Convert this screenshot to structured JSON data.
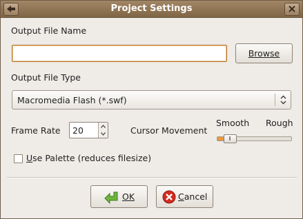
{
  "window": {
    "title": "Project Settings"
  },
  "output_file_name": {
    "label": "Output File Name",
    "value": "",
    "browse_button": "Browse"
  },
  "output_file_type": {
    "label": "Output File Type",
    "selected": "Macromedia Flash (*.swf)"
  },
  "frame_rate": {
    "label": "Frame Rate",
    "value": "20"
  },
  "cursor_movement": {
    "label": "Cursor Movement",
    "min_label": "Smooth",
    "max_label": "Rough",
    "level": 0.1
  },
  "use_palette": {
    "label": "Use Palette (reduces filesize)",
    "checked": false
  },
  "buttons": {
    "ok": "OK",
    "cancel": "Cancel"
  },
  "colors": {
    "titlebar": "#8e7352",
    "focus_border": "#b2712f",
    "slider_fill": "#e89a3c",
    "ok_icon": "#6fb43f",
    "cancel_icon": "#d22b20"
  }
}
